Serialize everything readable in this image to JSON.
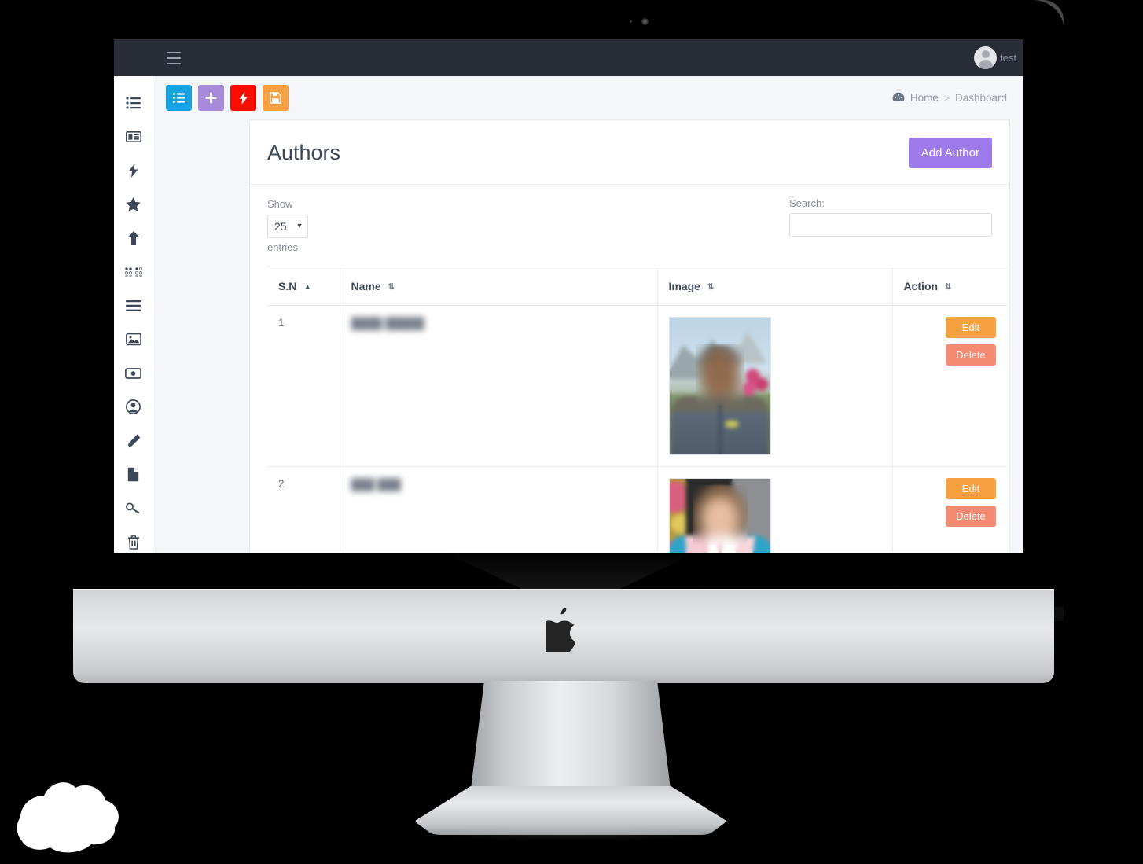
{
  "navbar": {
    "toggle_icon": "hamburger-menu-icon",
    "user_name": "test",
    "avatar_icon": "user-avatar-icon",
    "bg_color": "#272c37"
  },
  "sidebar": {
    "items": [
      {
        "icon": "list-ul-icon",
        "name": "sidebar-item-list"
      },
      {
        "icon": "newspaper-icon",
        "name": "sidebar-item-newspaper"
      },
      {
        "icon": "bolt-icon",
        "name": "sidebar-item-bolt"
      },
      {
        "icon": "star-icon",
        "name": "sidebar-item-star"
      },
      {
        "icon": "arrow-up-icon",
        "name": "sidebar-item-arrow-up"
      },
      {
        "icon": "braille-dots-icon",
        "name": "sidebar-item-braille"
      },
      {
        "icon": "bars-icon",
        "name": "sidebar-item-bars"
      },
      {
        "icon": "image-icon",
        "name": "sidebar-item-image"
      },
      {
        "icon": "money-bill-icon",
        "name": "sidebar-item-money"
      },
      {
        "icon": "user-circle-icon",
        "name": "sidebar-item-user"
      },
      {
        "icon": "pencil-icon",
        "name": "sidebar-item-pencil"
      },
      {
        "icon": "file-icon",
        "name": "sidebar-item-file"
      },
      {
        "icon": "key-icon",
        "name": "sidebar-item-key"
      },
      {
        "icon": "trash-icon",
        "name": "sidebar-item-trash"
      }
    ]
  },
  "toolbar": {
    "buttons": [
      {
        "icon": "list-icon",
        "color": "#17a2e0",
        "name": "quick-list-button"
      },
      {
        "icon": "plus-icon",
        "color": "#a78bda",
        "name": "quick-add-button"
      },
      {
        "icon": "bolt-icon",
        "color": "#fa0c00",
        "name": "quick-bolt-button"
      },
      {
        "icon": "save-icon",
        "color": "#f5a142",
        "name": "quick-save-button"
      }
    ]
  },
  "breadcrumb": {
    "icon": "tachometer-dashboard-icon",
    "home": "Home",
    "separator": ">",
    "current": "Dashboard"
  },
  "card": {
    "title": "Authors",
    "add_button": "Add Author",
    "add_button_color": "#9f7aea"
  },
  "table_controls": {
    "show_label": "Show",
    "entries_label": "entries",
    "page_length": "25",
    "caret_icon": "caret-down-icon",
    "search_label": "Search:",
    "search_value": "",
    "search_placeholder": ""
  },
  "table": {
    "columns": [
      {
        "label": "S.N",
        "sort": "asc",
        "sort_icon": "sort-asc-icon"
      },
      {
        "label": "Name",
        "sort": "none",
        "sort_icon": "sort-both-icon"
      },
      {
        "label": "Image",
        "sort": "none",
        "sort_icon": "sort-both-icon"
      },
      {
        "label": "Action",
        "sort": "none",
        "sort_icon": "sort-both-icon"
      }
    ],
    "rows": [
      {
        "sn": "1",
        "name": "████ █████",
        "image_alt": "author-photo-1",
        "edit_label": "Edit",
        "delete_label": "Delete"
      },
      {
        "sn": "2",
        "name": "███ ███",
        "image_alt": "author-photo-2",
        "edit_label": "Edit",
        "delete_label": "Delete"
      }
    ],
    "edit_color": "#f5a142",
    "delete_color": "#f58a72"
  },
  "device": {
    "brand_icon": "apple-logo-icon",
    "camera_icon": "webcam-icon"
  }
}
